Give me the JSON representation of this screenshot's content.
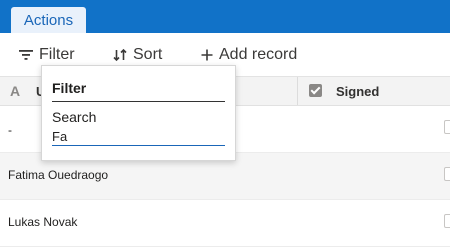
{
  "tabs": [
    {
      "label": "Actions"
    }
  ],
  "toolbar": {
    "filter_label": "Filter",
    "sort_label": "Sort",
    "add_label": "Add record",
    "filter_icon": "filter-icon",
    "sort_icon": "sort-icon",
    "add_icon": "plus-icon"
  },
  "table": {
    "columns": [
      {
        "label": "U",
        "icon": "text-type-icon"
      },
      {
        "label": "Signed",
        "icon": "checkbox-icon"
      }
    ],
    "rows": [
      {
        "name": "-",
        "signed": false
      },
      {
        "name": "Fatima Ouedraogo",
        "signed": false
      },
      {
        "name": "Lukas Novak",
        "signed": false
      }
    ]
  },
  "filter_popup": {
    "title": "Filter",
    "search_label": "Search",
    "search_value": "Fa"
  },
  "colors": {
    "topbar": "#1172c8",
    "tab_bg": "#e9f1fb",
    "accent": "#1a66b8"
  }
}
